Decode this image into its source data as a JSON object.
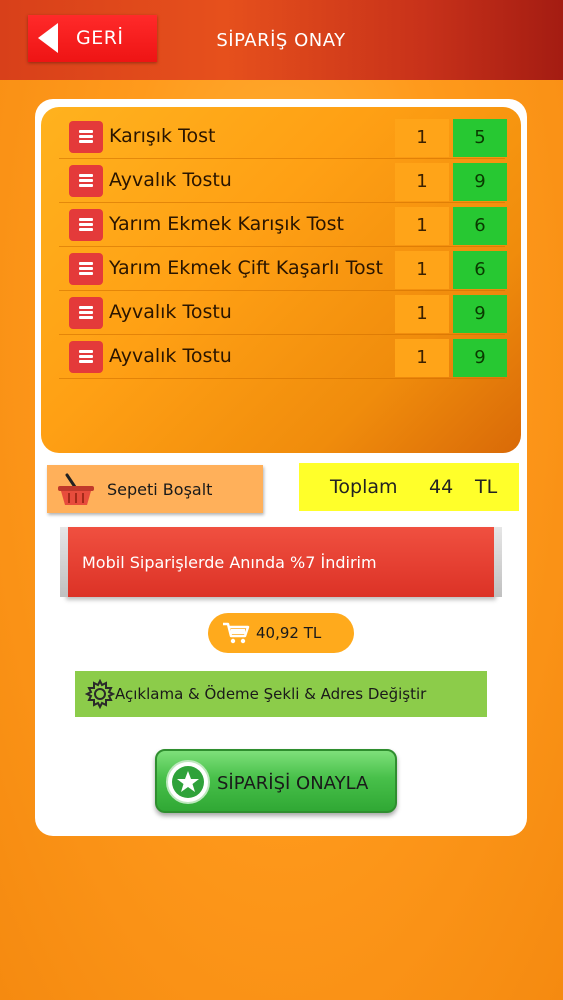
{
  "header": {
    "back_label": "GERİ",
    "title": "SİPARİŞ ONAY"
  },
  "orders": [
    {
      "name": "Karışık Tost",
      "qty": "1",
      "price": "5"
    },
    {
      "name": "Ayvalık Tostu",
      "qty": "1",
      "price": "9"
    },
    {
      "name": "Yarım Ekmek Karışık Tost",
      "qty": "1",
      "price": "6"
    },
    {
      "name": "Yarım Ekmek Çift Kaşarlı Tost",
      "qty": "1",
      "price": "6"
    },
    {
      "name": "Ayvalık Tostu",
      "qty": "1",
      "price": "9"
    },
    {
      "name": "Ayvalık Tostu",
      "qty": "1",
      "price": "9"
    }
  ],
  "clear_basket": {
    "label": "Sepeti Boşalt",
    "icon": "basket-icon"
  },
  "total": {
    "label": "Toplam",
    "value": "44",
    "currency": "TL"
  },
  "discount": {
    "text": "Mobil Siparişlerde Anında %7 İndirim"
  },
  "discounted_total": {
    "value": "40,92 TL",
    "icon": "cart-icon"
  },
  "details_button": {
    "label": "Açıklama & Ödeme Şekli & Adres Değiştir",
    "icon": "gear-icon"
  },
  "confirm_button": {
    "label": "SİPARİŞİ ONAYLA",
    "icon": "star-icon"
  },
  "colors": {
    "header": "#e6501c",
    "back_button": "#ff2a2a",
    "qty_cell": "#ffa418",
    "price_cell": "#27c832",
    "total_box": "#ffff2a",
    "discount_banner": "#dc3226",
    "details_button": "#8ccc4a",
    "confirm_button": "#48c04a"
  }
}
